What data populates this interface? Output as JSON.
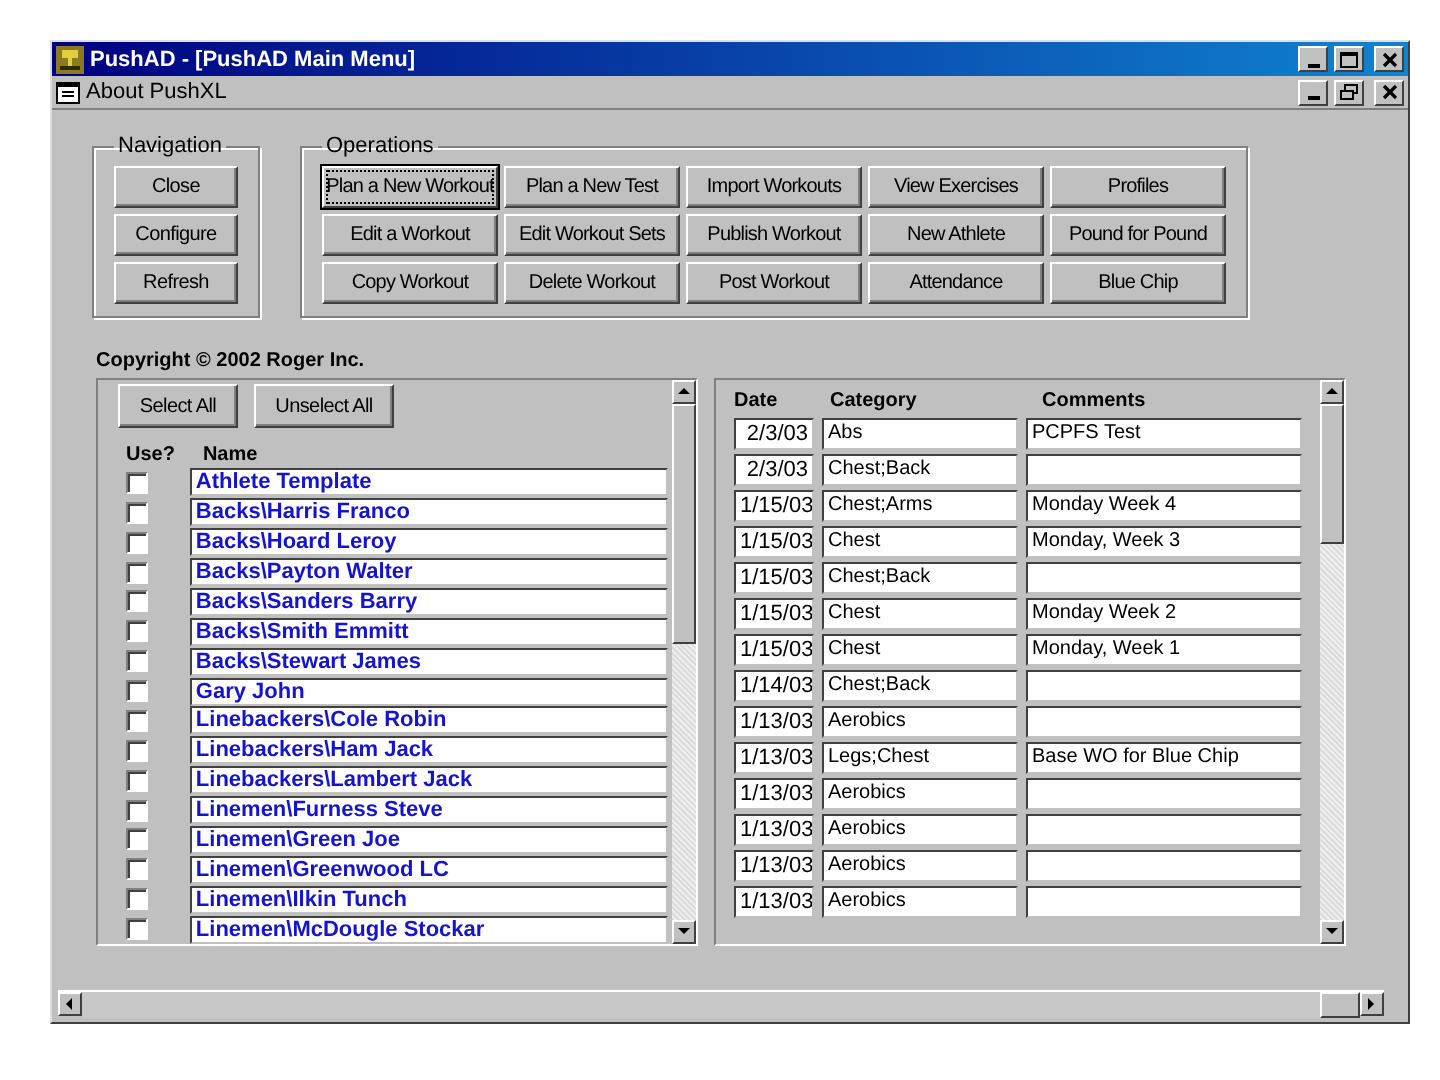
{
  "window": {
    "title": "PushAD - [PushAD Main Menu]"
  },
  "menu": {
    "items": [
      "About PushXL"
    ]
  },
  "navigation": {
    "title": "Navigation",
    "buttons": [
      {
        "label": "Close",
        "focused": false
      },
      {
        "label": "Configure",
        "focused": false
      },
      {
        "label": "Refresh",
        "focused": false
      }
    ]
  },
  "operations": {
    "title": "Operations",
    "buttons": [
      {
        "label": "Plan a New Workout",
        "focused": true
      },
      {
        "label": "Plan a New Test",
        "focused": false
      },
      {
        "label": "Import Workouts",
        "focused": false
      },
      {
        "label": "View Exercises",
        "focused": false
      },
      {
        "label": "Profiles",
        "focused": false
      },
      {
        "label": "Edit a Workout",
        "focused": false
      },
      {
        "label": "Edit Workout Sets",
        "focused": false
      },
      {
        "label": "Publish Workout",
        "focused": false
      },
      {
        "label": "New Athlete",
        "focused": false
      },
      {
        "label": "Pound for Pound",
        "focused": false
      },
      {
        "label": "Copy Workout",
        "focused": false
      },
      {
        "label": "Delete Workout",
        "focused": false
      },
      {
        "label": "Post Workout",
        "focused": false
      },
      {
        "label": "Attendance",
        "focused": false
      },
      {
        "label": "Blue Chip",
        "focused": false
      }
    ]
  },
  "copyright": "Copyright © 2002 Roger Inc.",
  "athletes": {
    "buttons": [
      "Select All",
      "Unselect All"
    ],
    "columns": [
      "Use?",
      "Name"
    ],
    "rows": [
      {
        "name": "Athlete Template",
        "checked": false
      },
      {
        "name": "Backs\\Harris Franco",
        "checked": false
      },
      {
        "name": "Backs\\Hoard Leroy",
        "checked": false
      },
      {
        "name": "Backs\\Payton Walter",
        "checked": false
      },
      {
        "name": "Backs\\Sanders Barry",
        "checked": false
      },
      {
        "name": "Backs\\Smith Emmitt",
        "checked": false
      },
      {
        "name": "Backs\\Stewart James",
        "checked": false
      },
      {
        "name": "Gary John",
        "checked": false
      },
      {
        "name": "Linebackers\\Cole Robin",
        "checked": false
      },
      {
        "name": "Linebackers\\Ham Jack",
        "checked": false
      },
      {
        "name": "Linebackers\\Lambert Jack",
        "checked": false
      },
      {
        "name": "Linemen\\Furness Steve",
        "checked": false
      },
      {
        "name": "Linemen\\Green Joe",
        "checked": false
      },
      {
        "name": "Linemen\\Greenwood LC",
        "checked": false
      },
      {
        "name": "Linemen\\Ilkin Tunch",
        "checked": false
      },
      {
        "name": "Linemen\\McDougle Stockar",
        "checked": false
      }
    ]
  },
  "workouts": {
    "columns": [
      "Date",
      "Category",
      "Comments"
    ],
    "rows": [
      {
        "date": "2/3/03",
        "category": "Abs",
        "comments": "PCPFS Test"
      },
      {
        "date": "2/3/03",
        "category": "Chest;Back"
      },
      {
        "date": "1/15/03",
        "category": "Chest;Arms",
        "comments": "Monday Week 4"
      },
      {
        "date": "1/15/03",
        "category": "Chest",
        "comments": "Monday, Week 3"
      },
      {
        "date": "1/15/03",
        "category": "Chest;Back"
      },
      {
        "date": "1/15/03",
        "category": "Chest",
        "comments": "Monday Week 2"
      },
      {
        "date": "1/15/03",
        "category": "Chest",
        "comments": "Monday, Week 1"
      },
      {
        "date": "1/14/03",
        "category": "Chest;Back"
      },
      {
        "date": "1/13/03",
        "category": "Aerobics"
      },
      {
        "date": "1/13/03",
        "category": "Legs;Chest",
        "comments": "Base WO for Blue Chip"
      },
      {
        "date": "1/13/03",
        "category": "Aerobics"
      },
      {
        "date": "1/13/03",
        "category": "Aerobics"
      },
      {
        "date": "1/13/03",
        "category": "Aerobics"
      },
      {
        "date": "1/13/03",
        "category": "Aerobics"
      }
    ]
  }
}
